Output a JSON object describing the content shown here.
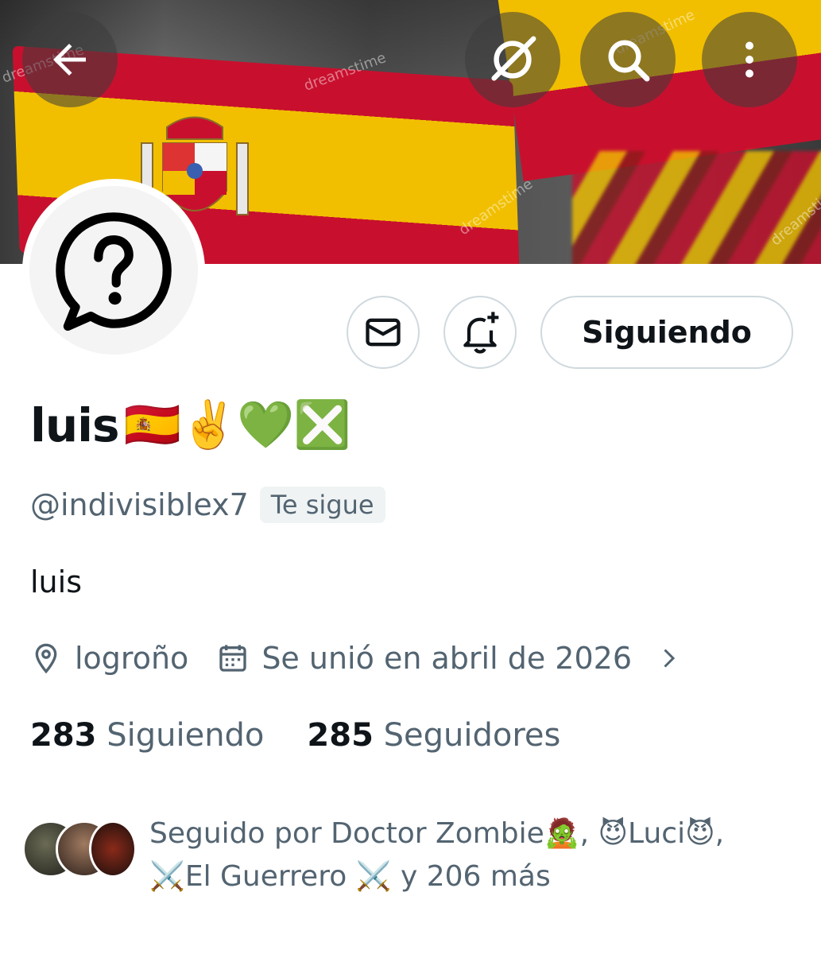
{
  "header": {
    "back_icon": "arrow-left-icon",
    "grok_icon": "slashed-circle-icon",
    "search_icon": "search-icon",
    "more_icon": "more-vertical-icon",
    "watermark": "dreamstime"
  },
  "profile": {
    "avatar_icon": "question-speech-bubble-icon",
    "name": "luis",
    "name_emojis": "🇪🇸✌️💚❎",
    "handle": "@indivisiblex7",
    "follows_you_badge": "Te sigue",
    "bio": "luis",
    "location": "logroño",
    "joined": "Se unió en abril de 2026",
    "following_count": "283",
    "following_label": "Siguiendo",
    "followers_count": "285",
    "followers_label": "Seguidores",
    "followed_by_line1": "Seguido por Doctor Zombie🧟, 😈Luci😈,",
    "followed_by_line2": "⚔️El Guerrero ⚔️ y 206 más"
  },
  "actions": {
    "message_icon": "envelope-icon",
    "notify_icon": "bell-plus-icon",
    "follow_button_label": "Siguiendo"
  },
  "colors": {
    "flag_red": "#c8102e",
    "flag_yellow": "#f1bf00",
    "secondary_text": "#536471",
    "border": "#cfd9de"
  }
}
